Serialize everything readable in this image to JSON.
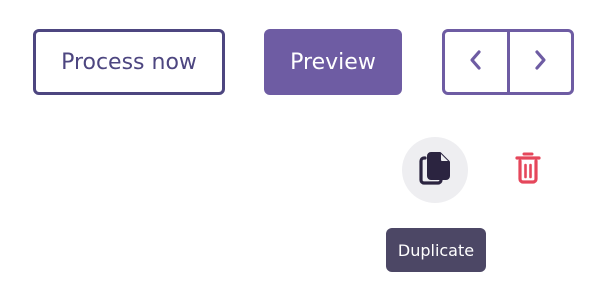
{
  "toolbar": {
    "process_now_label": "Process now",
    "preview_label": "Preview",
    "prev_icon": "chevron-left-icon",
    "next_icon": "chevron-right-icon"
  },
  "actions": {
    "duplicate_icon": "copy-icon",
    "delete_icon": "trash-icon",
    "tooltip": "Duplicate"
  },
  "colors": {
    "primary": "#6e5ca3",
    "outline": "#4d4680",
    "danger": "#e5475b",
    "tooltip_bg": "#4c4765",
    "icon_hover_bg": "#eeeef1"
  }
}
